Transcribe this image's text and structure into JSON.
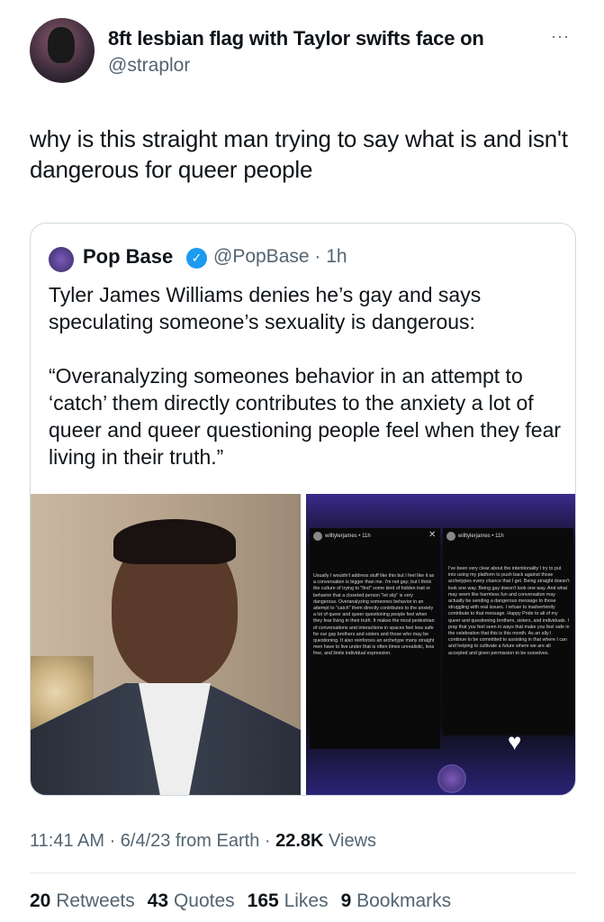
{
  "author": {
    "name": "8ft lesbian flag with Taylor swifts face on",
    "handle": "@straplor",
    "more_icon": "ellipsis-icon"
  },
  "tweet": {
    "text": "why is this straight man trying to say what is and isn't dangerous for queer people"
  },
  "quote": {
    "name": "Pop Base",
    "handle": "@PopBase · 1h",
    "verified_icon": "verified-badge-icon",
    "text": "Tyler James Williams denies he’s gay and says speculating someone’s sexuality is dangerous:\n\n“Overanalyzing someones behavior in an attempt to ‘catch’ them directly contributes to the anxiety a lot of queer and queer questioning people feel when they fear living in their truth.”",
    "story": {
      "p1_header": "willtylerjames • 11h",
      "p2_header": "willtylerjames • 11h",
      "p1_text": "Usually I wouldn't address stuff like this but I feel like it as a conversation is bigger than me. I'm not gay; but I think the culture of trying to \"find\" some kind of hidden trait or behavior that a closeted person \"let slip\" is very dangerous. Overanalyzing someones behavior in an attempt to \"catch\" them directly contributes to the anxiety a lot of queer and queer questioning people feel when they fear living in their truth. It makes the most pedestrian of conversations and interactions in spaces feel less safe for our gay brothers and sisters and those who may be questioning. It also reinforces an archetype many straight men have to live under that is often times unrealistic, less free, and limits individual expression.",
      "p2_text": "I've been very clear about the intentionality I try to put into using my platform to push back against those archetypes every chance that I get. Being straight doesn't look one way. Being gay doesn't look one way. And what may seem like harmless fun and conversation may actually be sending a dangerous message to those struggling with real issues. I refuse to inadvertently contribute to that message. Happy Pride to all of my queer and questioning brothers, sisters, and individuals. I pray that you feel seen in ways that make you feel safe in the celebration that this is this month. As an ally I continue to be committed to assisting in that where I can and helping to cultivate a future where we are all accepted and given permission to be ourselves."
    }
  },
  "meta": {
    "time_date": "11:41 AM · 6/4/23 from Earth · ",
    "views_count": "22.8K",
    "views_label": " Views"
  },
  "stats": {
    "retweets_count": "20",
    "retweets_label": "Retweets",
    "quotes_count": "43",
    "quotes_label": "Quotes",
    "likes_count": "165",
    "likes_label": "Likes",
    "bookmarks_count": "9",
    "bookmarks_label": "Bookmarks"
  }
}
